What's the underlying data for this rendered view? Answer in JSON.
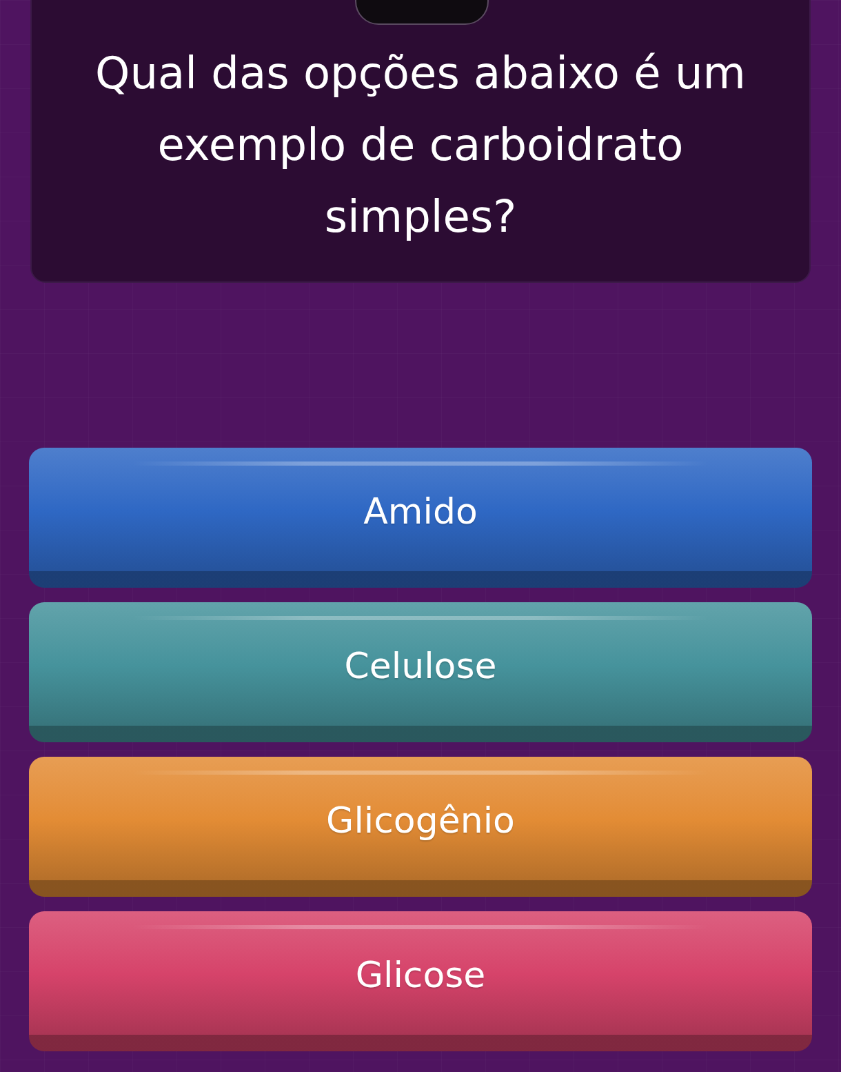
{
  "question": {
    "text": "Qual das opções abaixo é um exemplo de carboidrato simples?"
  },
  "answers": [
    {
      "label": "Amido",
      "color": "#2f68c4"
    },
    {
      "label": "Celulose",
      "color": "#46939c"
    },
    {
      "label": "Glicogênio",
      "color": "#e38c35"
    },
    {
      "label": "Glicose",
      "color": "#d6436a"
    }
  ]
}
